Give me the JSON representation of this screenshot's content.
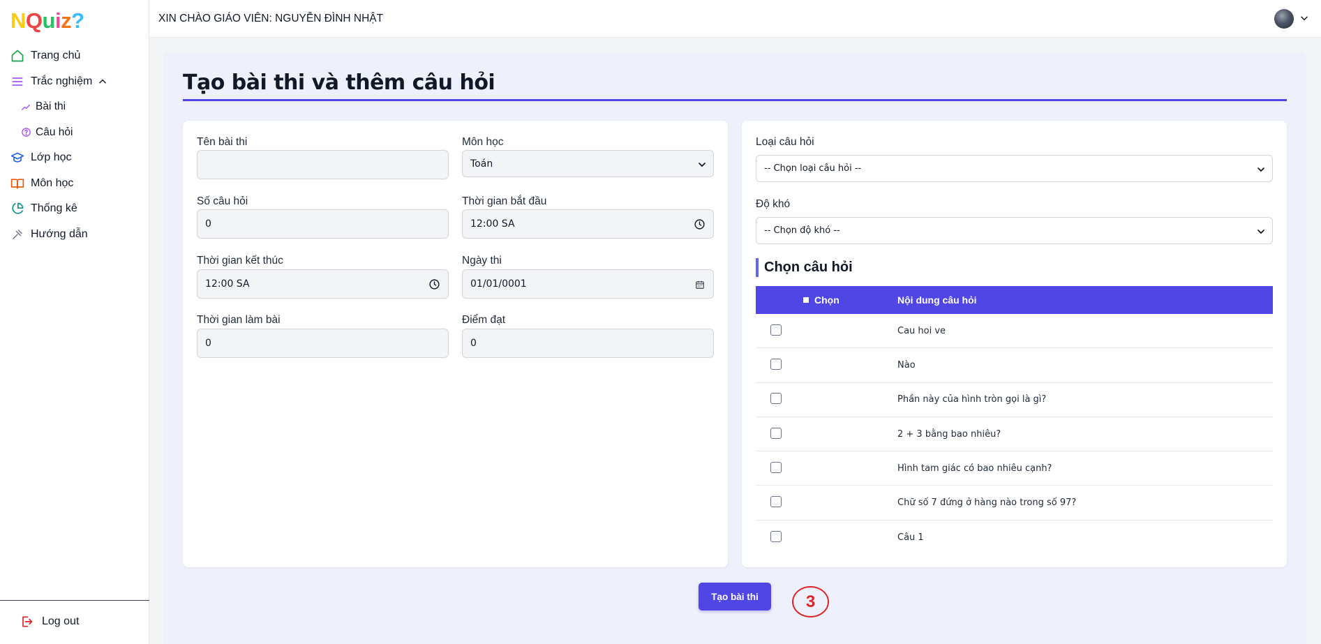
{
  "app": {
    "logo_letters": [
      "N",
      "Q",
      "u",
      "i",
      "z",
      "?"
    ],
    "logo_colors": [
      "#facc15",
      "#ef4444",
      "#22c55e",
      "#ec4899",
      "#f97316",
      "#38bdf8"
    ]
  },
  "sidebar": {
    "items": [
      {
        "label": "Trang chủ",
        "icon": "home-icon",
        "color": "#16a34a"
      },
      {
        "label": "Trắc nghiệm",
        "icon": "menu-icon",
        "color": "#a855f7"
      },
      {
        "label": "Bài thi",
        "icon": "chart-line-icon",
        "color": "#a855f7"
      },
      {
        "label": "Câu hỏi",
        "icon": "question-circle-icon",
        "color": "#a855f7"
      },
      {
        "label": "Lớp học",
        "icon": "graduation-cap-icon",
        "color": "#2563eb"
      },
      {
        "label": "Môn học",
        "icon": "book-icon",
        "color": "#ea580c"
      },
      {
        "label": "Thống kê",
        "icon": "pie-chart-icon",
        "color": "#0d9488"
      },
      {
        "label": "Hướng dẫn",
        "icon": "tool-icon",
        "color": "#6b7280"
      }
    ],
    "logout": "Log out"
  },
  "header": {
    "greeting": "XIN CHÀO GIÁO VIÊN: NGUYỄN ĐÌNH NHẬT"
  },
  "page": {
    "title": "Tạo bài thi và thêm câu hỏi"
  },
  "form": {
    "ten_bai_thi": {
      "label": "Tên bài thi",
      "value": ""
    },
    "mon_hoc": {
      "label": "Môn học",
      "value": "Toán"
    },
    "so_cau_hoi": {
      "label": "Số câu hỏi",
      "value": "0"
    },
    "tg_bat_dau": {
      "label": "Thời gian bắt đầu",
      "value": "12:00 SA"
    },
    "tg_ket_thuc": {
      "label": "Thời gian kết thúc",
      "value": "12:00 SA"
    },
    "ngay_thi": {
      "label": "Ngày thi",
      "value": "01/01/0001"
    },
    "tg_lam_bai": {
      "label": "Thời gian làm bài",
      "value": "0"
    },
    "diem_dat": {
      "label": "Điểm đạt",
      "value": "0"
    }
  },
  "filters": {
    "loai_cau_hoi": {
      "label": "Loại câu hỏi",
      "value": "-- Chọn loại câu hỏi --"
    },
    "do_kho": {
      "label": "Độ khó",
      "value": "-- Chọn độ khó --"
    }
  },
  "questions": {
    "heading": "Chọn câu hỏi",
    "col_select": "Chọn",
    "col_content": "Nội dung câu hỏi",
    "rows": [
      {
        "text": "Cau hoi ve",
        "checked": false
      },
      {
        "text": "Nào",
        "checked": false
      },
      {
        "text": "Phần này của hình tròn gọi là gì?",
        "checked": false
      },
      {
        "text": "2 + 3 bằng bao nhiêu?",
        "checked": false
      },
      {
        "text": "Hình tam giác có bao nhiêu cạnh?",
        "checked": false
      },
      {
        "text": "Chữ số 7 đứng ở hàng nào trong số 97?",
        "checked": false
      },
      {
        "text": "Câu 1",
        "checked": false
      }
    ]
  },
  "actions": {
    "submit": "Tạo bài thi",
    "step_badge": "3"
  },
  "colors": {
    "accent": "#4f46e5",
    "badge": "#dc2626"
  }
}
